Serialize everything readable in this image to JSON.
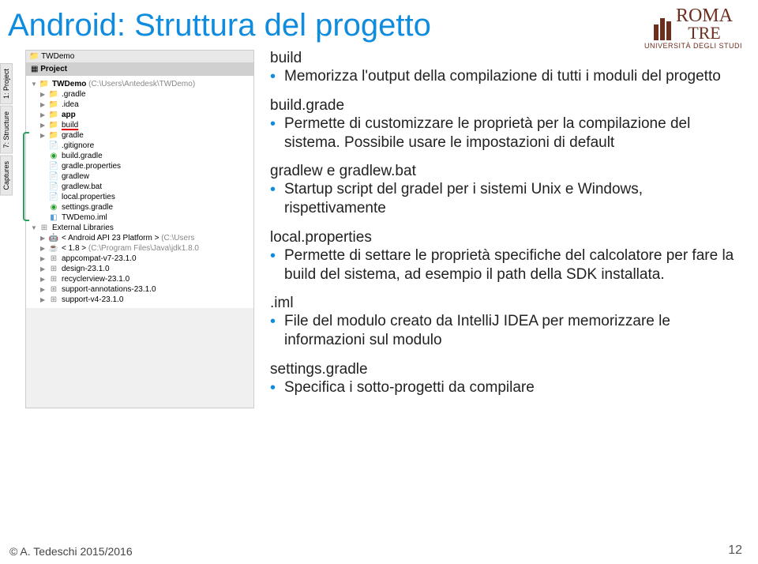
{
  "title": "Android: Struttura del progetto",
  "logo": {
    "name": "ROMA",
    "suffix": "TRE",
    "subtitle": "UNIVERSITÀ DEGLI STUDI"
  },
  "sidetabs": {
    "t1": "1: Project",
    "t2": "7: Structure",
    "t3": "Captures"
  },
  "ide": {
    "tab": "TWDemo",
    "project_label": "Project",
    "root": "TWDemo",
    "root_path": "(C:\\Users\\Antedesk\\TWDemo)",
    "items": {
      "gradle_dir": ".gradle",
      "idea_dir": ".idea",
      "app": "app",
      "build": "build",
      "gradle_folder": "gradle",
      "gitignore": ".gitignore",
      "build_gradle": "build.gradle",
      "gradle_props": "gradle.properties",
      "gradlew": "gradlew",
      "gradlew_bat": "gradlew.bat",
      "local_props": "local.properties",
      "settings_gradle": "settings.gradle",
      "twdemo_iml": "TWDemo.iml",
      "ext_libs": "External Libraries",
      "android_api": "< Android API 23 Platform >",
      "android_api_path": "(C:\\Users",
      "jdk": "< 1.8 >",
      "jdk_path": "(C:\\Program Files\\Java\\jdk1.8.0",
      "appcompat": "appcompat-v7-23.1.0",
      "design": "design-23.1.0",
      "recyclerview": "recyclerview-23.1.0",
      "support_ann": "support-annotations-23.1.0",
      "support_v4": "support-v4-23.1.0"
    }
  },
  "sections": {
    "build": {
      "title": "build",
      "bullet": "Memorizza l'output della compilazione di tutti i moduli del progetto"
    },
    "buildgrade": {
      "title": "build.grade",
      "bullet": "Permette di customizzare le proprietà per la compilazione del sistema. Possibile usare le impostazioni di default"
    },
    "gradlew": {
      "title": "gradlew e gradlew.bat",
      "bullet": "Startup script del gradel per i sistemi Unix e Windows, rispettivamente"
    },
    "localprops": {
      "title": "local.properties",
      "bullet": "Permette di settare le proprietà specifiche del calcolatore per fare la build del sistema, ad esempio il path della SDK installata."
    },
    "iml": {
      "title": ".iml",
      "bullet": "File del modulo creato da IntelliJ IDEA per memorizzare le informazioni sul modulo"
    },
    "settings": {
      "title": "settings.gradle",
      "bullet": "Specifica i sotto-progetti da compilare"
    }
  },
  "footer": "© A. Tedeschi 2015/2016",
  "pagenum": "12"
}
